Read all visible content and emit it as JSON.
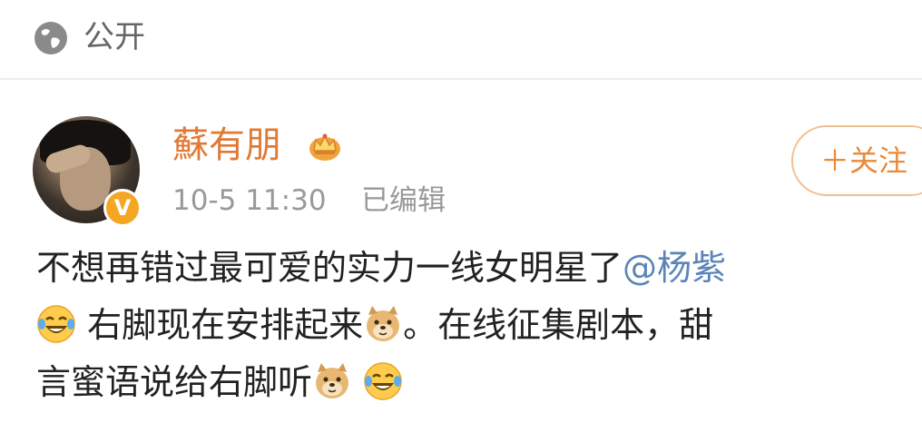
{
  "header": {
    "visibility_icon": "globe-icon",
    "visibility_label": "公开"
  },
  "post": {
    "author": {
      "name": "蘇有朋",
      "badge_icon": "crown-icon",
      "verified_icon": "verified-v-icon",
      "verified_mark": "V"
    },
    "timestamp": "10-5 11:30",
    "edited_label": "已编辑",
    "follow_label": "＋关注",
    "content": {
      "line1_text": "不想再错过最可爱的实力一线女明星了",
      "line1_mention": "@杨紫",
      "line2_text_a": " 右脚现在安排起来",
      "line2_text_b": "。在线征集剧本，甜",
      "line3_text": "言蜜语说给右脚听"
    },
    "emojis": [
      "laughing-tears-emoji",
      "doge-emoji",
      "doge-emoji",
      "laughing-tears-emoji"
    ]
  },
  "colors": {
    "username": "#e07a35",
    "mention": "#5b84b8",
    "follow_border": "#f2c090",
    "follow_text": "#ea8a36",
    "meta_text": "#999999",
    "verified_badge": "#f5a623"
  }
}
